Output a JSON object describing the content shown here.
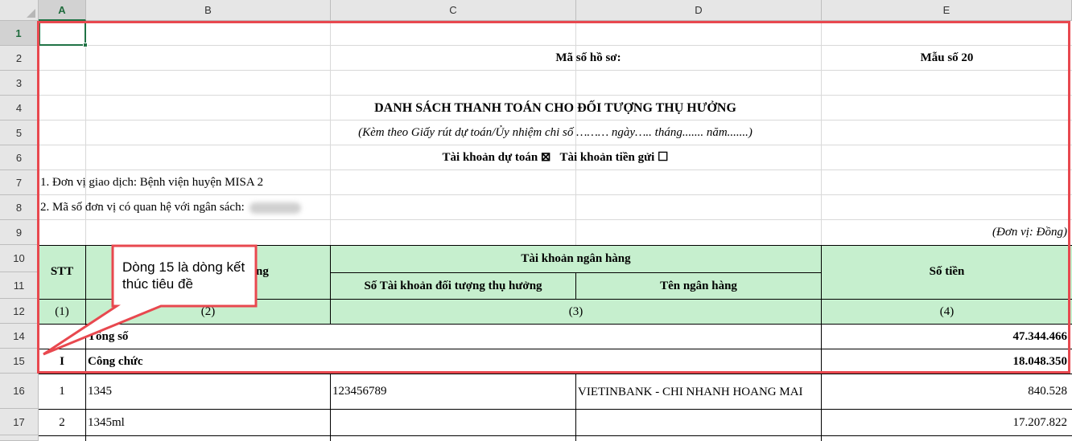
{
  "columns": [
    "A",
    "B",
    "C",
    "D",
    "E"
  ],
  "rows": [
    "1",
    "2",
    "3",
    "4",
    "5",
    "6",
    "7",
    "8",
    "9",
    "10",
    "11",
    "12",
    "14",
    "15",
    "16",
    "17"
  ],
  "header": {
    "ma_so_ho_so": "Mã số hồ sơ:",
    "mau_so": "Mẫu số 20",
    "title": "DANH SÁCH THANH TOÁN CHO ĐỐI TƯỢNG THỤ HƯỞNG",
    "subtitle": "(Kèm theo Giấy rút dự toán/Ủy nhiệm chi số ……… ngày….. tháng....... năm.......)",
    "account_line": "Tài khoản dự toán ⊠   Tài khoản tiền gửi ☐",
    "unit_label": "1. Đơn vị giao dịch: Bệnh viện huyện MISA 2",
    "unit_code_label": "2. Mã số đơn vị có quan hệ với ngân sách:",
    "currency_note": "(Đơn vị: Đồng)"
  },
  "table_header": {
    "stt": "STT",
    "name_partial": "ng",
    "bank_account": "Tài khoản ngân hàng",
    "account_number": "Số Tài khoản đối tượng thụ hưởng",
    "bank_name": "Tên ngân hàng",
    "amount": "Số tiền",
    "idx_1": "(1)",
    "idx_2": "(2)",
    "idx_3": "(3)",
    "idx_4": "(4)"
  },
  "table_rows": {
    "total_label": "Tổng số",
    "total_value": "47.344.466",
    "group_stt": "I",
    "group_label": "Công chức",
    "group_value": "18.048.350",
    "r16_stt": "1",
    "r16_code": "1345",
    "r16_account": "123456789",
    "r16_bank": "VIETINBANK - CHI NHANH HOANG MAI",
    "r16_amount": "840.528",
    "r17_stt": "2",
    "r17_code": "1345ml",
    "r17_amount": "17.207.822"
  },
  "callout": {
    "text": "Dòng 15 là dòng kết thúc tiêu đề"
  },
  "colors": {
    "header_green": "#c6efce",
    "excel_green": "#217346",
    "annotation_red": "#e8484f"
  }
}
